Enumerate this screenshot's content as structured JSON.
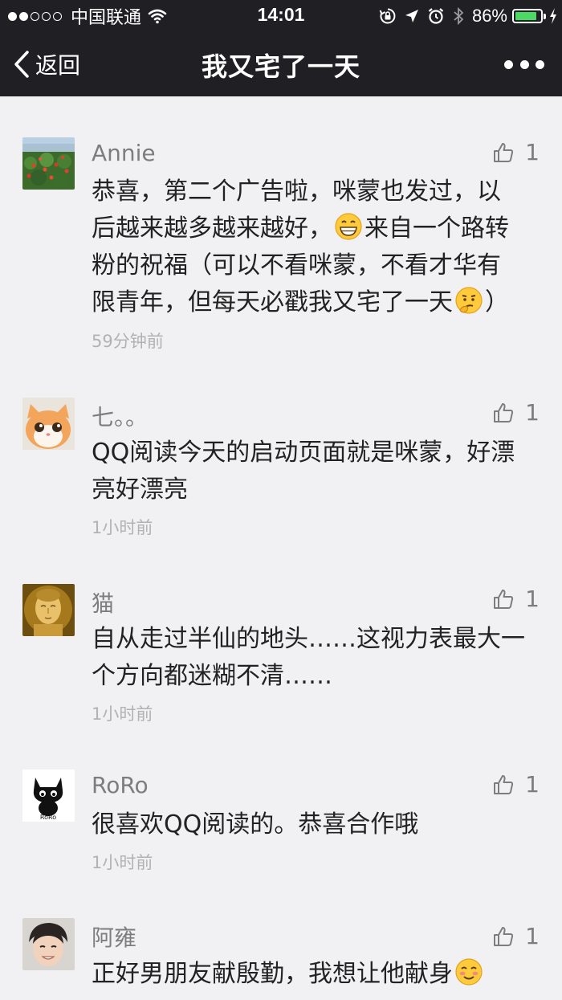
{
  "status_bar": {
    "carrier": "中国联通",
    "time": "14:01",
    "battery": "86%",
    "battery_level": 0.86,
    "icons": [
      "signal-dots-icon",
      "wifi-icon",
      "rotation-lock-icon",
      "location-icon",
      "alarm-icon",
      "bluetooth-icon",
      "battery-icon",
      "charging-icon"
    ]
  },
  "nav": {
    "back_label": "返回",
    "title": "我又宅了一天",
    "more_icon": "more-dots-icon"
  },
  "colors": {
    "bar_bg": "#1f1f24",
    "page_bg": "#f1f1f3",
    "name": "#7d7d7d",
    "text": "#222222",
    "time": "#b2b2b2",
    "battery": "#4cd964"
  },
  "comments": [
    {
      "name": "Annie",
      "likes": "1",
      "lines": [
        "恭喜，第二个广告啦，咪蒙也发过，以",
        "后越来越多越来越好，",
        "来自一个路转",
        "粉的祝福（可以不看咪蒙，不看才华有",
        "限青年，但每天必戳我又宅了一天",
        "）"
      ],
      "emojis": [
        "grin-emoji",
        "thinking-emoji"
      ],
      "time": "59分钟前"
    },
    {
      "name": "七。。",
      "likes": "1",
      "lines": [
        "QQ阅读今天的启动页面就是咪蒙，好漂",
        "亮好漂亮"
      ],
      "time": "1小时前"
    },
    {
      "name": "猫",
      "likes": "1",
      "lines": [
        "自从走过半仙的地头……这视力表最大一",
        "个方向都迷糊不清……"
      ],
      "time": "1小时前"
    },
    {
      "name": "RoRo",
      "likes": "1",
      "lines": [
        "很喜欢QQ阅读的。恭喜合作哦"
      ],
      "time": "1小时前"
    },
    {
      "name": "阿雍",
      "likes": "1",
      "lines": [
        "正好男朋友献殷勤，我想让他献身"
      ],
      "emojis": [
        "blush-emoji"
      ]
    }
  ],
  "avatar_text": {
    "roro": "RoRo"
  }
}
